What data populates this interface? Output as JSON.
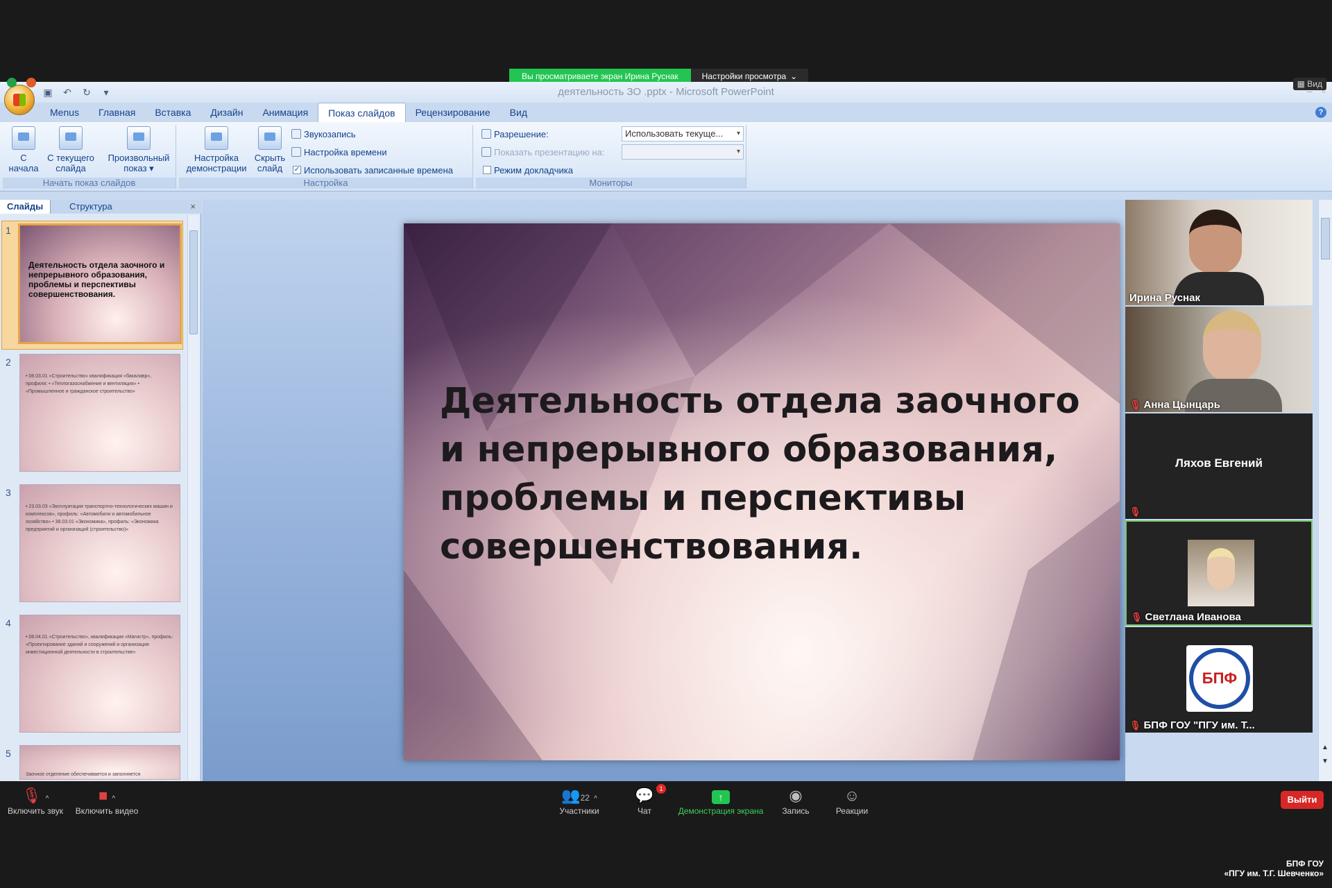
{
  "share_banner": {
    "viewing": "Вы просматриваете экран Ирина Руснак",
    "settings": "Настройки просмотра"
  },
  "window": {
    "title": "деятельность ЗО .pptx - Microsoft PowerPoint",
    "view_button": "Вид"
  },
  "tabs": [
    "Menus",
    "Главная",
    "Вставка",
    "Дизайн",
    "Анимация",
    "Показ слайдов",
    "Рецензирование",
    "Вид"
  ],
  "active_tab": "Показ слайдов",
  "ribbon": {
    "start_group": {
      "label": "Начать показ слайдов",
      "from_start": "С начала",
      "from_current_1": "С текущего",
      "from_current_2": "слайда",
      "custom_1": "Произвольный",
      "custom_2": "показ ▾"
    },
    "setup_group": {
      "label": "Настройка",
      "setup_1": "Настройка",
      "setup_2": "демонстрации",
      "hide_1": "Скрыть",
      "hide_2": "слайд",
      "record": "Звукозапись",
      "timing": "Настройка времени",
      "use_timings": "Использовать записанные времена"
    },
    "monitors_group": {
      "label": "Мониторы",
      "resolution_label": "Разрешение:",
      "resolution_value": "Использовать текуще...",
      "show_on_label": "Показать презентацию на:",
      "presenter_view": "Режим докладчика"
    }
  },
  "pane": {
    "tabs": [
      "Слайды",
      "Структура"
    ],
    "slides": [
      {
        "num": "1",
        "title": "Деятельность отдела заочного и непрерывного образования, проблемы и перспективы совершенствования."
      },
      {
        "num": "2",
        "text": "• 08.03.01 «Строительство» квалификация «бакалавр», профили: • «Теплогазоснабжение и вентиляция» • «Промышленное и гражданское строительство»"
      },
      {
        "num": "3",
        "text": "• 23.03.03 «Эксплуатация транспортно-технологических машин и комплексов», профиль: «Автомобили и автомобильное хозяйство» • 38.03.01 «Экономика», профиль: «Экономика предприятий и организаций (строительство)»"
      },
      {
        "num": "4",
        "text": "• 08.04.01 «Строительство», квалификация «Магистр», профиль: «Проектирование зданий и сооружений и организация инвестиционной деятельности в строительстве»"
      },
      {
        "num": "5",
        "text": "Заочное отделение обеспечивается и заполняется"
      }
    ]
  },
  "slide": {
    "title": "Деятельность отдела заочного и непрерывного образования, проблемы и перспективы совершенствования."
  },
  "participants": [
    {
      "name": "Ирина Руснак"
    },
    {
      "name": "Анна Цынцарь"
    },
    {
      "name": "Ляхов Евгений"
    },
    {
      "name": "Светлана Иванова"
    },
    {
      "name": "БПФ ГОУ \"ПГУ им. Т..."
    }
  ],
  "logo_text": "БПФ",
  "zoom": {
    "unmute": "Включить звук",
    "start_video": "Включить видео",
    "participants": "Участники",
    "participants_count": "22",
    "chat": "Чат",
    "chat_badge": "1",
    "share": "Демонстрация экрана",
    "record": "Запись",
    "reactions": "Реакции",
    "leave": "Выйти"
  },
  "watermark": {
    "line1": "БПФ ГОУ",
    "line2": "«ПГУ им. Т.Г. Шевченко»"
  },
  "colors": {
    "zoom_green": "#23c552",
    "leave_red": "#d82727",
    "ribbon_blue": "#15428b"
  }
}
